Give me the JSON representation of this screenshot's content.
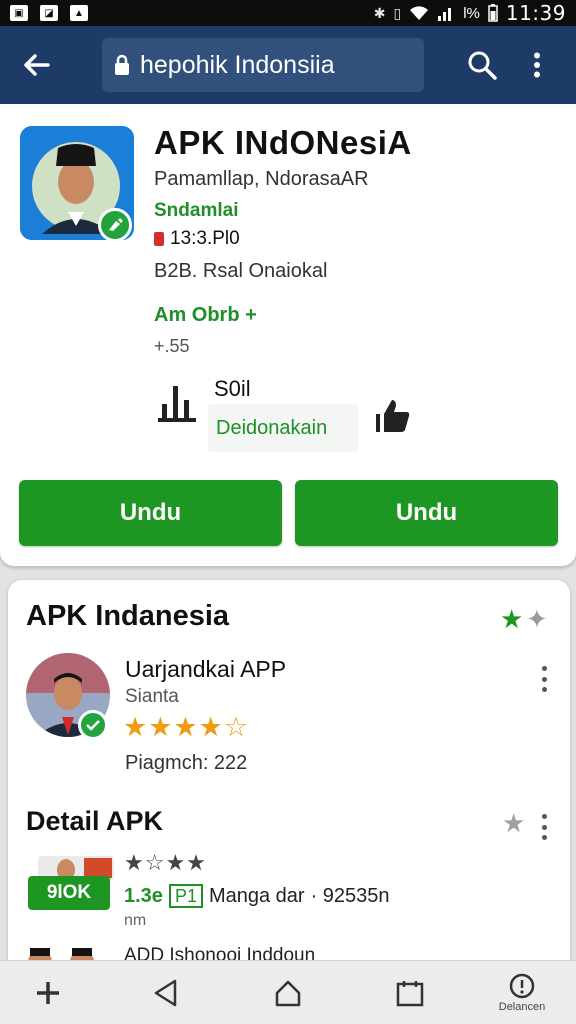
{
  "status_bar": {
    "time": "11:39",
    "battery": "l%",
    "icons": [
      "gallery-icon",
      "image-icon",
      "image-icon",
      "bluetooth-icon",
      "vibrate-icon",
      "wifi-icon",
      "signal-icon",
      "battery-icon"
    ]
  },
  "toolbar": {
    "search_text": "hepohik Indonsiia"
  },
  "app": {
    "title": "APK INdONesiA",
    "developer": "Pamamllap, NdorasaAR",
    "category": "Sndamlai",
    "rating_age": "13:3.Pl0",
    "size": "B2B. Rsal Onaiokal",
    "installs": "Am Obrb +",
    "reviews": "+.55",
    "stat_label": "S0il",
    "stat_sub": "Deidonakain",
    "button_left": "Undu",
    "button_right": "Undu"
  },
  "list_card": {
    "section_title": "APK Indanesia",
    "item_title": "Uarjandkai APP",
    "item_subtitle": "Sianta",
    "item_stars": "★★★★☆",
    "item_note": "Piagmch: 222",
    "detail_title": "Detail APK",
    "chip_label": "9lOK",
    "detail_stars": "★☆★★",
    "detail_prefix": "1.3e",
    "detail_code": "P1",
    "detail_text": "Manga dar",
    "detail_size": "· 92535n",
    "detail_unit": "nm",
    "cut_text": "ADD Ishonooi Inddoun"
  },
  "bottom_nav": {
    "last_label": "Delancen"
  },
  "colors": {
    "toolbar": "#1d3b66",
    "green": "#1e9624",
    "star": "#f19b10"
  }
}
